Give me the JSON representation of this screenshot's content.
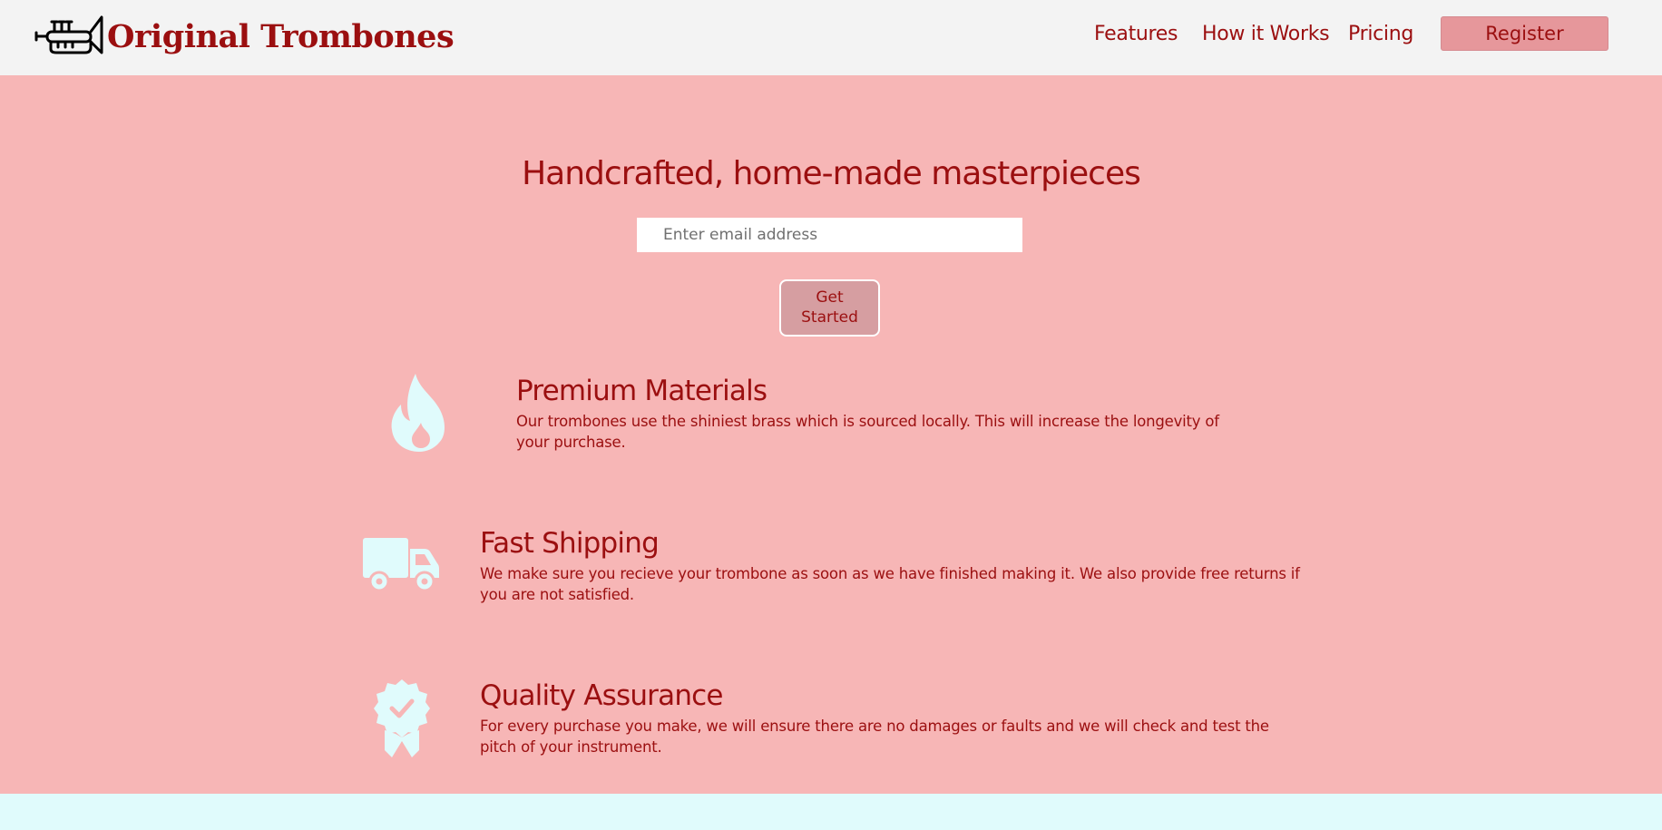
{
  "header": {
    "brand": "Original Trombones",
    "logo_icon": "trumpet-icon",
    "nav": [
      {
        "label": "Features"
      },
      {
        "label": "How it Works"
      },
      {
        "label": "Pricing"
      }
    ],
    "register_label": "Register"
  },
  "hero": {
    "title": "Handcrafted, home-made masterpieces",
    "email_placeholder": "Enter email address",
    "email_value": "",
    "cta_line1": "Get",
    "cta_line2": "Started"
  },
  "features": [
    {
      "icon": "fire-icon",
      "title": "Premium Materials",
      "description": "Our trombones use the shiniest brass which is sourced locally. This will increase the longevity of your purchase."
    },
    {
      "icon": "truck-icon",
      "title": "Fast Shipping",
      "description": "We make sure you recieve your trombone as soon as we have finished making it. We also provide free returns if you are not satisfied."
    },
    {
      "icon": "certificate-icon",
      "title": "Quality Assurance",
      "description": "For every purchase you make, we will ensure there are no damages or faults and we will check and test the pitch of your instrument."
    }
  ],
  "colors": {
    "header_bg": "#f3f3f3",
    "hero_bg": "#f7b6b6",
    "accent_text": "#9b0f10",
    "register_bg": "#e6979b",
    "button_bg": "#d69ea1",
    "icon_color": "#e0fbfc",
    "footer_bg": "#e0fbfc"
  }
}
